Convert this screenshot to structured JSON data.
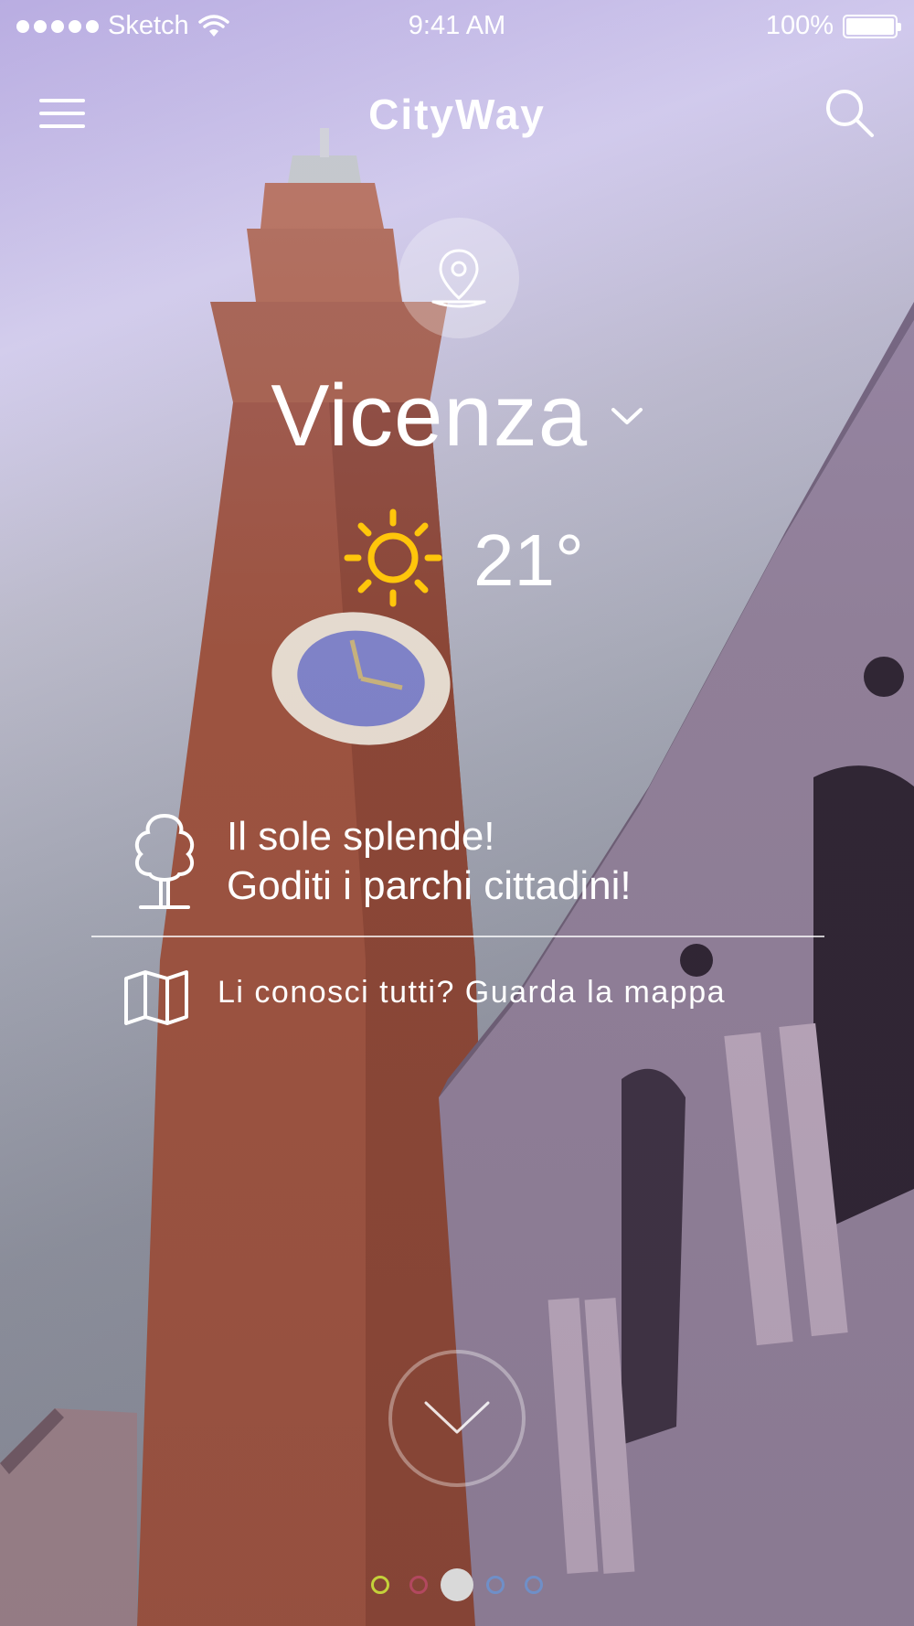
{
  "status_bar": {
    "carrier": "Sketch",
    "time": "9:41 AM",
    "battery": "100%"
  },
  "header": {
    "title": "CityWay",
    "menu_icon": "hamburger-icon",
    "search_icon": "search-icon"
  },
  "location": {
    "icon": "location-pin-icon",
    "city": "Vicenza",
    "dropdown_icon": "chevron-down-icon"
  },
  "weather": {
    "icon": "sun-icon",
    "temperature": "21°",
    "icon_color": "#FFC60B"
  },
  "suggestion": {
    "icon": "tree-icon",
    "line1": "Il sole splende!",
    "line2": "Goditi i parchi cittadini!"
  },
  "map_link": {
    "icon": "map-icon",
    "text": "Li conosci tutti? Guarda la mappa"
  },
  "scroll": {
    "icon": "chevron-down-icon"
  },
  "pager": {
    "total": 5,
    "active_index": 2,
    "dot_colors": [
      "#c4d13a",
      "#b2485f",
      "#d9d9d9",
      "#6f8fc8",
      "#6f8fc8"
    ]
  }
}
